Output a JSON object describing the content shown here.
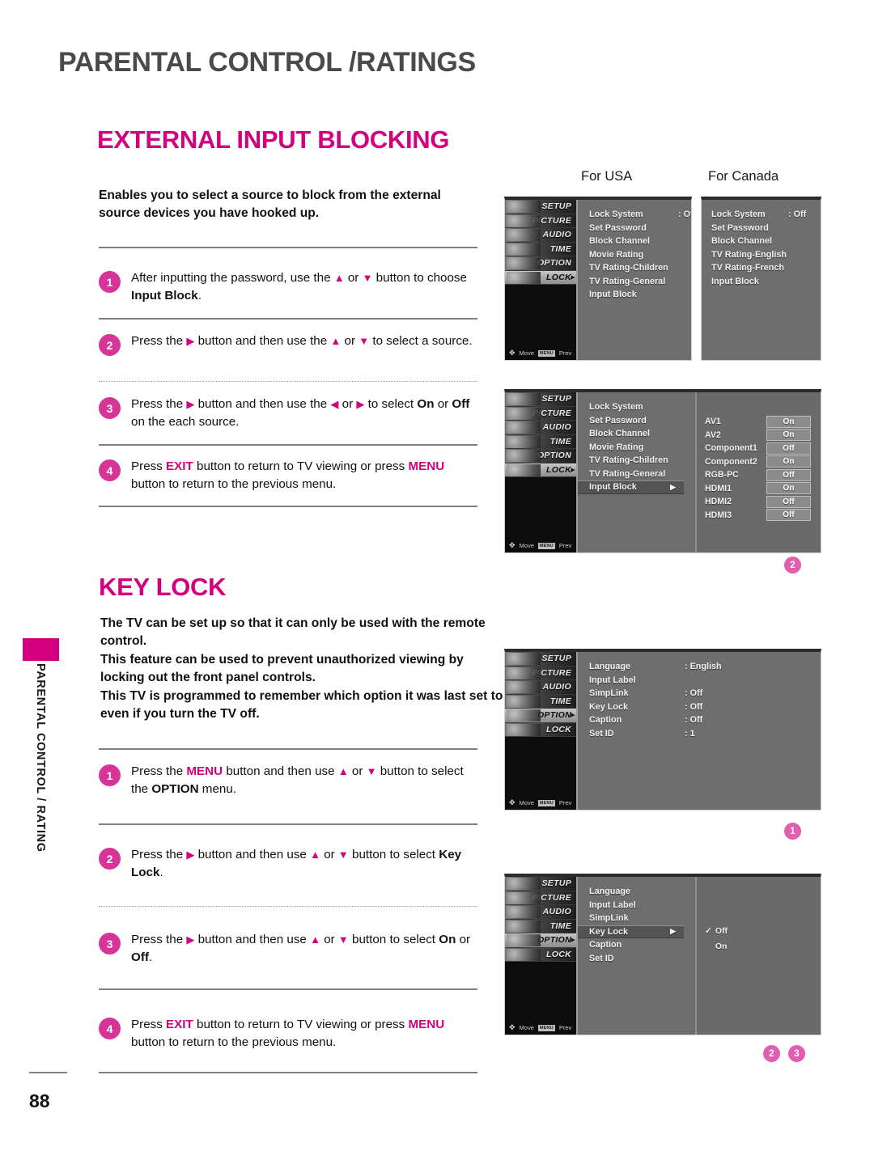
{
  "page": {
    "chapter_title": "PARENTAL CONTROL /RATINGS",
    "page_number": "88",
    "side_tab_text": "PARENTAL CONTROL / RATING",
    "accent_color": "#D2007F",
    "callout_color": "#E15FAE"
  },
  "section1": {
    "title": "EXTERNAL INPUT BLOCKING",
    "intro": "Enables you to select a source to block from the external source devices you have hooked up.",
    "steps": [
      {
        "num": "1",
        "pre": "After inputting the password, use the ",
        "up": "▲",
        "mid": " or ",
        "down": "▼",
        "post": " button to choose ",
        "bold": "Input Block",
        "tail": "."
      },
      {
        "num": "2",
        "pre": "Press the ",
        "up": "▶",
        "mid": " button and then use the ",
        "post": " to select a source.",
        "alt_up": "▲",
        "alt_down": "▼"
      },
      {
        "num": "3",
        "pre": "Press the ",
        "up": "▶",
        "mid": " button and then use the ",
        "post": " to select ",
        "bold1": "On",
        "between": " or ",
        "bold2": "Off",
        "tail": " on the each source.",
        "alt_left": "◀",
        "alt_right": "▶"
      },
      {
        "num": "4",
        "pre": "Press ",
        "key1": "EXIT",
        "mid": " button to return to TV viewing or press ",
        "key2": "MENU",
        "post": " button to return to the previous menu."
      }
    ]
  },
  "section2": {
    "title": "KEY LOCK",
    "intro": "The TV can be set up so that it can only be used with the remote control.\nThis feature can be used to prevent unauthorized viewing by locking out the front panel controls.\nThis TV is programmed to remember which option it was last set to even if you turn the TV off.",
    "steps": [
      {
        "num": "1",
        "pre": "Press the ",
        "key1": "MENU",
        "mid": " button and then use ",
        "up": "▲",
        "or": " or ",
        "down": "▼",
        "post": " button to select the ",
        "bold": "OPTION",
        "tail": " menu."
      },
      {
        "num": "2",
        "pre": "Press the ",
        "up": "▶",
        "mid": " button and then use ",
        "a": "▲",
        "or": " or ",
        "b": "▼",
        "post": " button to select ",
        "bold": "Key Lock",
        "tail": "."
      },
      {
        "num": "3",
        "pre": "Press the ",
        "up": "▶",
        "mid": " button and then use ",
        "a": "▲",
        "or": " or ",
        "b": "▼",
        "post": " button to select ",
        "bold1": "On",
        "between": " or ",
        "bold2": "Off",
        "tail": "."
      },
      {
        "num": "4",
        "pre": "Press ",
        "key1": "EXIT",
        "mid": " button to return to TV viewing or press ",
        "key2": "MENU",
        "post": " button to return to the previous menu."
      }
    ]
  },
  "osd_captions": {
    "usa": "For USA",
    "canada": "For Canada"
  },
  "menu_icons": [
    {
      "label": "SETUP",
      "selected": false
    },
    {
      "label": "PICTURE",
      "selected": false
    },
    {
      "label": "AUDIO",
      "selected": false
    },
    {
      "label": "TIME",
      "selected": false
    },
    {
      "label": "OPTION",
      "selected": false
    },
    {
      "label": "LOCK",
      "selected": true
    }
  ],
  "osd_footer": {
    "move": "Move",
    "menu_key": "MENU",
    "prev": "Prev"
  },
  "osd_usa": {
    "rows": [
      {
        "label": "Lock System",
        "value": ": Off"
      },
      {
        "label": "Set Password",
        "value": ""
      },
      {
        "label": "Block Channel",
        "value": ""
      },
      {
        "label": "Movie Rating",
        "value": ""
      },
      {
        "label": "TV Rating-Children",
        "value": ""
      },
      {
        "label": "TV Rating-General",
        "value": ""
      },
      {
        "label": "Input Block",
        "value": ""
      }
    ]
  },
  "osd_canada": {
    "rows": [
      {
        "label": "Lock System",
        "value": ": Off"
      },
      {
        "label": "Set Password",
        "value": ""
      },
      {
        "label": "Block Channel",
        "value": ""
      },
      {
        "label": "TV Rating-English",
        "value": ""
      },
      {
        "label": "TV Rating-French",
        "value": ""
      },
      {
        "label": "Input Block",
        "value": ""
      }
    ]
  },
  "osd_inputblock": {
    "rows": [
      {
        "label": "Lock System"
      },
      {
        "label": "Set Password"
      },
      {
        "label": "Block Channel"
      },
      {
        "label": "Movie Rating"
      },
      {
        "label": "TV Rating-Children"
      },
      {
        "label": "TV Rating-General"
      },
      {
        "label": "Input Block",
        "highlighted": true,
        "arrow": "▶"
      }
    ],
    "sources": [
      {
        "name": "AV1",
        "state": "On"
      },
      {
        "name": "AV2",
        "state": "On"
      },
      {
        "name": "Component1",
        "state": "Off"
      },
      {
        "name": "Component2",
        "state": "On"
      },
      {
        "name": "RGB-PC",
        "state": "Off"
      },
      {
        "name": "HDMI1",
        "state": "On"
      },
      {
        "name": "HDMI2",
        "state": "Off"
      },
      {
        "name": "HDMI3",
        "state": "Off"
      }
    ],
    "callout": "2"
  },
  "osd_option": {
    "rows": [
      {
        "label": "Language",
        "value": ": English"
      },
      {
        "label": "Input Label",
        "value": ""
      },
      {
        "label": "SimpLink",
        "value": ": Off"
      },
      {
        "label": "Key Lock",
        "value": ": Off"
      },
      {
        "label": "Caption",
        "value": ": Off"
      },
      {
        "label": "Set ID",
        "value": ": 1"
      }
    ],
    "selected_icon": "OPTION",
    "callout": "1"
  },
  "osd_keylock": {
    "rows": [
      {
        "label": "Language"
      },
      {
        "label": "Input Label"
      },
      {
        "label": "SimpLink"
      },
      {
        "label": "Key Lock",
        "highlighted": true,
        "arrow": "▶"
      },
      {
        "label": "Caption"
      },
      {
        "label": "Set ID"
      }
    ],
    "choices": [
      {
        "label": "Off",
        "checked": true,
        "check": "✓"
      },
      {
        "label": "On",
        "checked": false
      }
    ],
    "selected_icon": "OPTION",
    "callouts": [
      "2",
      "3"
    ]
  }
}
